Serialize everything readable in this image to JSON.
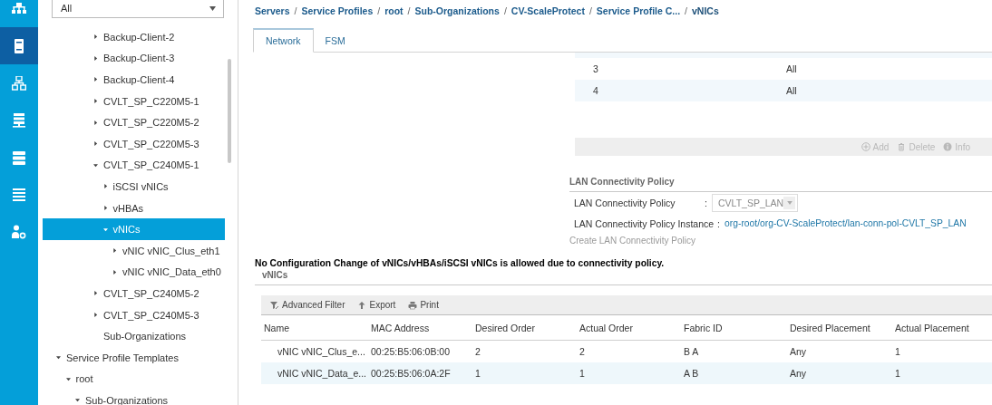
{
  "nav_rail": [
    {
      "selected": false
    },
    {
      "selected": true
    },
    {
      "selected": false
    },
    {
      "selected": false
    },
    {
      "selected": false
    },
    {
      "selected": false
    },
    {
      "selected": false
    }
  ],
  "sidebar": {
    "filter": {
      "value": "All"
    },
    "tree": [
      {
        "label": "Backup-Client-2",
        "expanded": false,
        "selected": false
      },
      {
        "label": "Backup-Client-3",
        "expanded": false,
        "selected": false
      },
      {
        "label": "Backup-Client-4",
        "expanded": false,
        "selected": false
      },
      {
        "label": "CVLT_SP_C220M5-1",
        "expanded": false,
        "selected": false
      },
      {
        "label": "CVLT_SP_C220M5-2",
        "expanded": false,
        "selected": false
      },
      {
        "label": "CVLT_SP_C220M5-3",
        "expanded": false,
        "selected": false
      },
      {
        "label": "CVLT_SP_C240M5-1",
        "expanded": true,
        "selected": false,
        "children": [
          {
            "label": "iSCSI vNICs",
            "expanded": false,
            "selected": false
          },
          {
            "label": "vHBAs",
            "expanded": false,
            "selected": false
          },
          {
            "label": "vNICs",
            "expanded": true,
            "selected": true,
            "children": [
              {
                "label": "vNIC vNIC_Clus_eth1",
                "expanded": false,
                "selected": false
              },
              {
                "label": "vNIC vNIC_Data_eth0",
                "expanded": false,
                "selected": false
              }
            ]
          }
        ]
      },
      {
        "label": "CVLT_SP_C240M5-2",
        "expanded": false,
        "selected": false
      },
      {
        "label": "CVLT_SP_C240M5-3",
        "expanded": false,
        "selected": false
      },
      {
        "label": "Sub-Organizations",
        "selected": false
      }
    ],
    "tree_continued": [
      {
        "label": "Service Profile Templates",
        "expanded": true,
        "selected": false,
        "children": [
          {
            "label": "root",
            "expanded": true,
            "selected": false,
            "children": [
              {
                "label": "Sub-Organizations",
                "expanded": true,
                "selected": false
              }
            ]
          }
        ]
      }
    ]
  },
  "main": {
    "breadcrumb_separator": "/",
    "breadcrumb": [
      "Servers",
      "Service Profiles",
      "root",
      "Sub-Organizations",
      "CV-ScaleProtect",
      "Service Profile C...",
      "vNICs"
    ],
    "tabs": [
      {
        "label": "Network",
        "selected": true
      },
      {
        "label": "FSM",
        "selected": false
      }
    ],
    "upper_table": {
      "rows": [
        [
          "3",
          "All"
        ],
        [
          "4",
          "All"
        ]
      ],
      "actions": [
        {
          "label": "Add",
          "kind": "add",
          "disabled": true
        },
        {
          "label": "Delete",
          "kind": "delete",
          "disabled": true
        },
        {
          "label": "Info",
          "kind": "info",
          "disabled": true
        }
      ]
    },
    "lan_policy": {
      "title": "LAN Connectivity Policy",
      "fields": [
        {
          "label": "LAN Connectivity Policy",
          "separator": ":",
          "kind": "select",
          "value": "CVLT_SP_LAN",
          "disabled": true
        },
        {
          "label": "LAN Connectivity Policy Instance",
          "separator": ":",
          "kind": "link",
          "value": "org-root/org-CV-ScaleProtect/lan-conn-pol-CVLT_SP_LAN"
        }
      ],
      "create_link": {
        "label": "Create LAN Connectivity Policy",
        "disabled": true
      }
    },
    "warning": "No Configuration Change of vNICs/vHBAs/iSCSI vNICs is allowed due to connectivity policy.",
    "vnics": {
      "title": "vNICs",
      "toolbar": [
        {
          "label": "Advanced Filter",
          "kind": "filter"
        },
        {
          "label": "Export",
          "kind": "export"
        },
        {
          "label": "Print",
          "kind": "print"
        }
      ],
      "columns": [
        "Name",
        "MAC Address",
        "Desired Order",
        "Actual Order",
        "Fabric ID",
        "Desired Placement",
        "Actual Placement"
      ],
      "rows": [
        [
          "vNIC vNIC_Clus_e...",
          "00:25:B5:06:0B:00",
          "2",
          "2",
          "B A",
          "Any",
          "1"
        ],
        [
          "vNIC vNIC_Data_e...",
          "00:25:B5:06:0A:2F",
          "1",
          "1",
          "A B",
          "Any",
          "1"
        ]
      ]
    }
  }
}
